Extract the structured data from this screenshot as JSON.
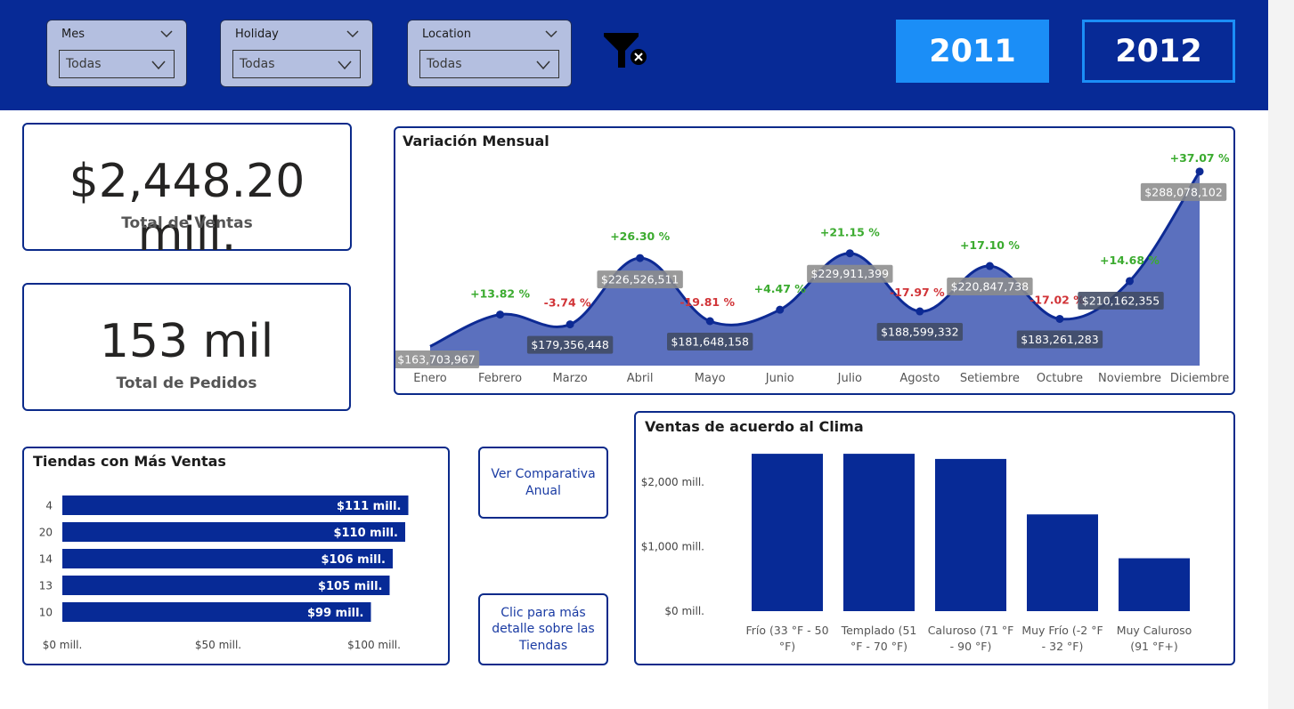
{
  "slicers": [
    {
      "title": "Mes",
      "value": "Todas"
    },
    {
      "title": "Holiday",
      "value": "Todas"
    },
    {
      "title": "Location",
      "value": "Todas"
    }
  ],
  "years": [
    "2011",
    "2012"
  ],
  "kpis": {
    "sales_value": "$2,448.20 mill.",
    "sales_label": "Total de Ventas",
    "orders_value": "153 mil",
    "orders_label": "Total de Pedidos"
  },
  "buttons": {
    "compare": "Ver Comparativa Anual",
    "stores_detail": "Clic para más detalle sobre las Tiendas"
  },
  "colors": {
    "header": "#072a96",
    "accent": "#1b8ef7",
    "bar": "#072a96",
    "area": "#5b70be",
    "positive": "#3bab2f",
    "negative": "#d13438"
  },
  "chart_data": [
    {
      "type": "area",
      "title": "Variación Mensual",
      "categories": [
        "Enero",
        "Febrero",
        "Marzo",
        "Abril",
        "Mayo",
        "Junio",
        "Julio",
        "Agosto",
        "Setiembre",
        "Octubre",
        "Noviembre",
        "Diciembre"
      ],
      "values": [
        163703967,
        186343000,
        179356448,
        226526511,
        181648158,
        189768000,
        229911399,
        188599332,
        220847738,
        183261283,
        210162355,
        288078102
      ],
      "value_labels": [
        "$163,703,967",
        "",
        "$179,356,448",
        "$226,526,511",
        "$181,648,158",
        "",
        "$229,911,399",
        "$188,599,332",
        "$220,847,738",
        "$183,261,283",
        "$210,162,355",
        "$288,078,102"
      ],
      "variation_labels": [
        "",
        "+13.82 %",
        "-3.74 %",
        "+26.30 %",
        "-19.81 %",
        "+4.47 %",
        "+21.15 %",
        "-17.97 %",
        "+17.10 %",
        "-17.02 %",
        "+14.68 %",
        "+37.07 %"
      ]
    },
    {
      "type": "bar",
      "orientation": "horizontal",
      "title": "Tiendas con Más Ventas",
      "categories": [
        "4",
        "20",
        "14",
        "13",
        "10"
      ],
      "values": [
        111,
        110,
        106,
        105,
        99
      ],
      "value_labels": [
        "$111 mill.",
        "$110 mill.",
        "$106 mill.",
        "$105 mill.",
        "$99 mill."
      ],
      "xticks": [
        "$0 mill.",
        "$50 mill.",
        "$100 mill."
      ],
      "xtick_values": [
        0,
        50,
        100
      ],
      "unit": "mill."
    },
    {
      "type": "bar",
      "title": "Ventas de acuerdo al Clima",
      "categories": [
        "Frío (33 °F - 50 °F)",
        "Templado (51 °F - 70 °F)",
        "Caluroso (71 °F - 90 °F)",
        "Muy Frío (-2 °F - 32 °F)",
        "Muy Caluroso (91 °F+)"
      ],
      "category_lines": [
        [
          "Frío (33 °F - 50",
          "°F)"
        ],
        [
          "Templado (51",
          "°F - 70 °F)"
        ],
        [
          "Caluroso (71 °F",
          "- 90 °F)"
        ],
        [
          "Muy Frío (-2 °F",
          "- 32 °F)"
        ],
        [
          "Muy Caluroso",
          "(91 °F+)"
        ]
      ],
      "values": [
        2440,
        2440,
        2360,
        1500,
        820
      ],
      "yticks": [
        "$0 mill.",
        "$1,000 mill.",
        "$2,000 mill."
      ],
      "ytick_values": [
        0,
        1000,
        2000
      ],
      "unit": "mill."
    }
  ]
}
